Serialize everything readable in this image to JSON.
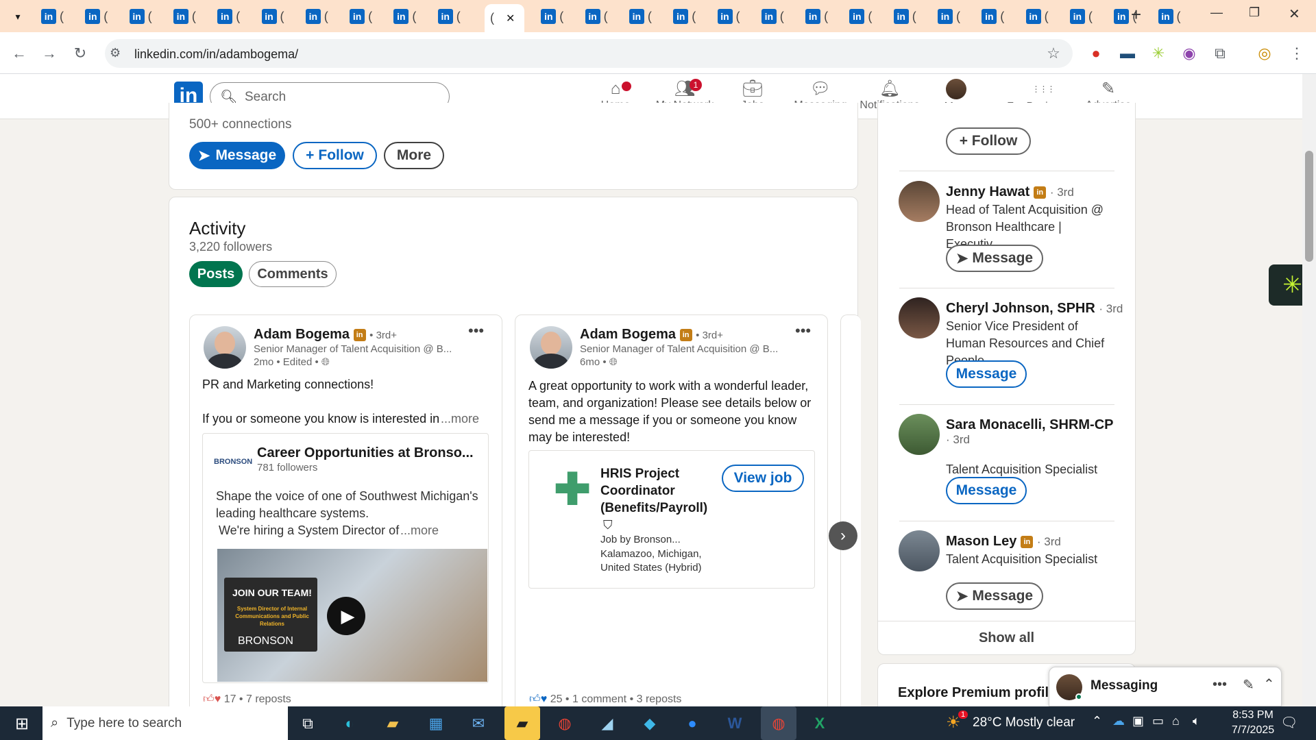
{
  "browser": {
    "tab_count_li": 25,
    "active_tab_close": "✕",
    "new_tab": "+",
    "url": "linkedin.com/in/adambogema/",
    "win_controls": [
      "—",
      "❐",
      "✕"
    ]
  },
  "linkedin": {
    "logo": "in",
    "search_placeholder": "Search",
    "nav": [
      {
        "label": "Home",
        "badge": ""
      },
      {
        "label": "My Network",
        "badge": "1"
      },
      {
        "label": "Jobs",
        "badge": ""
      },
      {
        "label": "Messaging",
        "badge": ""
      },
      {
        "label": "Notifications",
        "badge": ""
      },
      {
        "label": "Me ▾",
        "badge": ""
      },
      {
        "label": "For Business ▾",
        "badge": ""
      },
      {
        "label": "Advertise",
        "badge": ""
      }
    ]
  },
  "profile": {
    "connections": "500+ connections",
    "message_btn": "Message",
    "follow_btn": "Follow",
    "more_btn": "More"
  },
  "activity": {
    "title": "Activity",
    "followers": "3,220 followers",
    "tab_posts": "Posts",
    "tab_comments": "Comments",
    "posts": [
      {
        "author": "Adam Bogema",
        "degree": "• 3rd+",
        "headline": "Senior Manager of Talent Acquisition @ B...",
        "meta": "2mo • Edited •",
        "text1": "PR and Marketing connections!",
        "text2": "If you or someone you know is interested in",
        "more": "...more",
        "embed_title": "Career Opportunities at Bronso...",
        "embed_followers": "781 followers",
        "embed_logo": "BRONSON",
        "embed_text1": "Shape the voice of one of Southwest Michigan's",
        "embed_text2": "leading healthcare systems.",
        "embed_text3": "We're hiring a System Director of",
        "embed_more": "...more",
        "video_badge": "JOIN OUR TEAM!",
        "video_sub": "System Director of Internal Communications and Public Relations",
        "video_brand": "BRONSON",
        "reactions": "17 • 7 reposts"
      },
      {
        "author": "Adam Bogema",
        "degree": "• 3rd+",
        "headline": "Senior Manager of Talent Acquisition @ B...",
        "meta": "6mo •",
        "text": "A great opportunity to work with a wonderful leader, team, and organization! Please see details below or send me a message if you or someone you know may be interested!",
        "job_title": "HRIS Project Coordinator (Benefits/Payroll)",
        "job_by": "Job by Bronson...",
        "job_loc": "Kalamazoo, Michigan, United States (Hybrid)",
        "view_job": "View job",
        "reactions": "25 • 1 comment • 3 reposts"
      }
    ]
  },
  "sidebar": {
    "follow_btn": "Follow",
    "people": [
      {
        "name": "Jenny Hawat",
        "degree": "· 3rd",
        "headline": "Head of Talent Acquisition @ Bronson Healthcare | Executiv...",
        "action": "Message",
        "icon": true
      },
      {
        "name": "Cheryl Johnson, SPHR",
        "degree": "· 3rd",
        "headline": "Senior Vice President of Human Resources and Chief People...",
        "action": "Message",
        "icon": false
      },
      {
        "name": "Sara Monacelli, SHRM-CP",
        "degree": "· 3rd",
        "headline": "Talent Acquisition Specialist",
        "action": "Message",
        "icon": false
      },
      {
        "name": "Mason Ley",
        "degree": "· 3rd",
        "headline": "Talent Acquisition Specialist",
        "action": "Message",
        "icon": true
      }
    ],
    "show_all": "Show all",
    "premium": "Explore Premium profile"
  },
  "messaging": {
    "label": "Messaging"
  },
  "taskbar": {
    "search_placeholder": "Type here to search",
    "weather": "28°C  Mostly clear",
    "time": "8:53 PM",
    "date": "7/7/2025",
    "notif": "1"
  },
  "colors": {
    "li_blue": "#0a66c2",
    "green": "#01754f",
    "tab_bg": "#fde2cc"
  }
}
